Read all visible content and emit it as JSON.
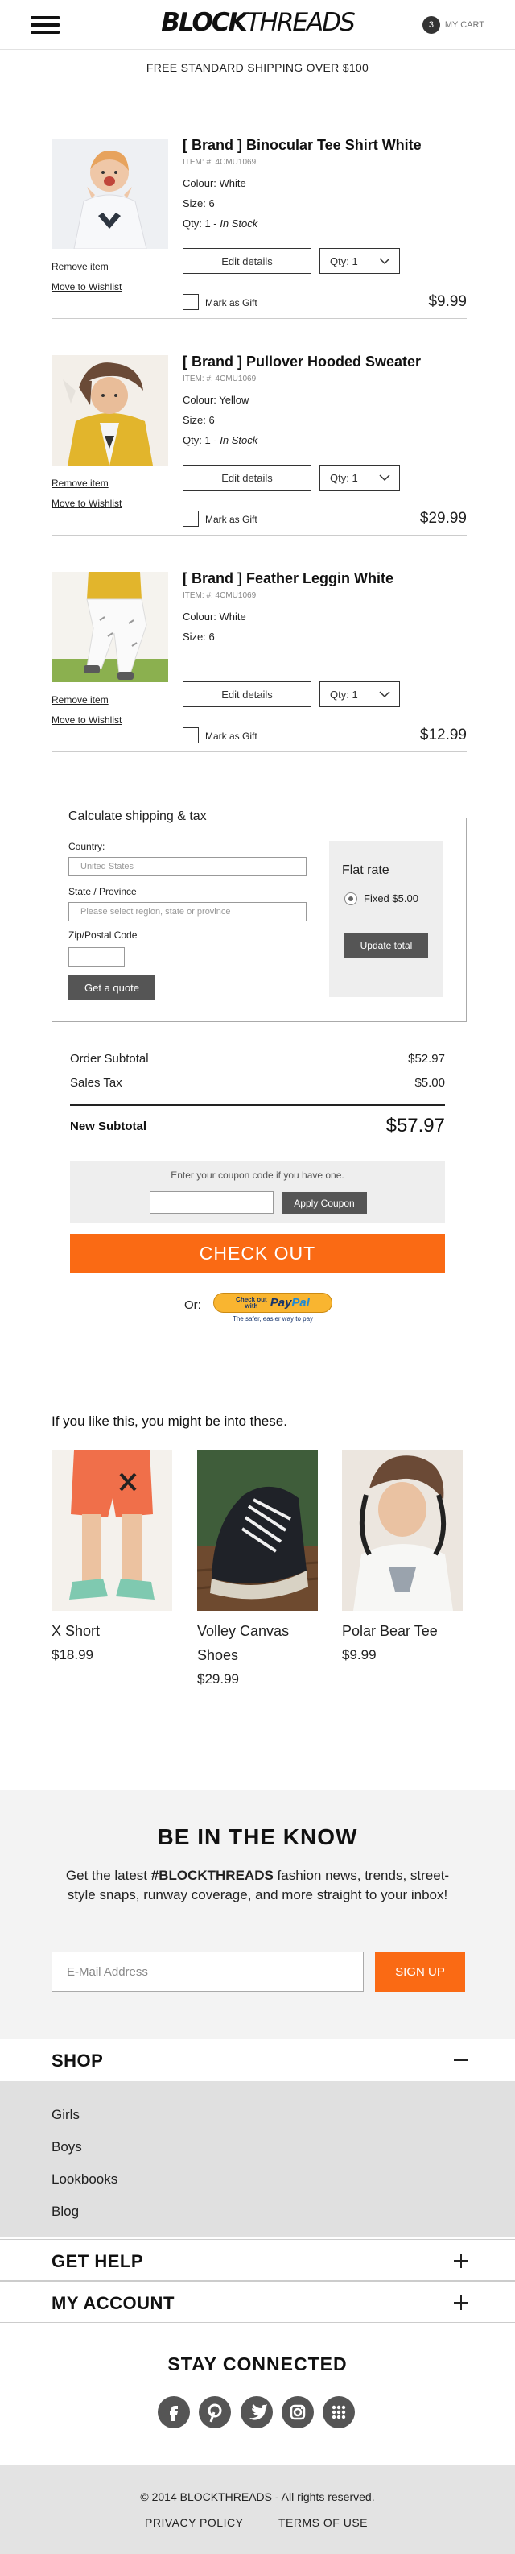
{
  "header": {
    "logo_bold": "BLOCK",
    "logo_thin": "THREADS",
    "cart_count": "3",
    "cart_label": "MY CART"
  },
  "promo": "FREE STANDARD SHIPPING OVER $100",
  "item_actions": {
    "remove": "Remove item",
    "wishlist": "Move to Wishlist",
    "edit": "Edit details",
    "gift": "Mark as Gift"
  },
  "items": [
    {
      "title": "[ Brand ] Binocular Tee Shirt White",
      "sku": "ITEM: #: 4CMU1069",
      "colour": "Colour: White",
      "size": "Size: 6",
      "qty_prefix": "Qty: 1 - ",
      "stock": "In Stock",
      "qty_select": "Qty: 1",
      "price": "$9.99"
    },
    {
      "title": "[ Brand ] Pullover Hooded Sweater",
      "sku": "ITEM: #: 4CMU1069",
      "colour": "Colour:  Yellow",
      "size": "Size: 6",
      "qty_prefix": "Qty: 1 - ",
      "stock": "In Stock",
      "qty_select": "Qty: 1",
      "price": "$29.99"
    },
    {
      "title": "[ Brand ] Feather Leggin White",
      "sku": "ITEM: #: 4CMU1069",
      "colour": "Colour:  White",
      "size": "Size: 6",
      "qty_select": "Qty: 1",
      "price": "$12.99"
    }
  ],
  "shipping": {
    "legend": "Calculate shipping & tax",
    "country_label": "Country:",
    "country_value": "United States",
    "state_label": "State / Province",
    "state_placeholder": "Please select region, state or province",
    "zip_label": "Zip/Postal Code",
    "quote_button": "Get a quote",
    "rate_title": "Flat rate",
    "rate_option": "Fixed $5.00",
    "update_button": "Update total"
  },
  "totals": {
    "subtotal_label": "Order Subtotal",
    "subtotal_value": "$52.97",
    "tax_label": "Sales Tax",
    "tax_value": "$5.00",
    "new_label": "New Subtotal",
    "new_value": "$57.97"
  },
  "coupon": {
    "prompt": "Enter your coupon code if you have one.",
    "button": "Apply Coupon"
  },
  "checkout": {
    "button": "CHECK OUT",
    "or": "Or:",
    "paypal_top": "Check out",
    "paypal_with": "with",
    "paypal_logo_a": "Pay",
    "paypal_logo_b": "Pal",
    "paypal_tagline": "The safer, easier way to pay"
  },
  "recommendations": {
    "heading": "If you like this, you might be into these.",
    "products": [
      {
        "name": "X Short",
        "price": "$18.99"
      },
      {
        "name": "Volley Canvas Shoes",
        "price": "$29.99"
      },
      {
        "name": "Polar Bear Tee",
        "price": "$9.99"
      }
    ]
  },
  "newsletter": {
    "title": "BE IN THE KNOW",
    "text_a": "Get the latest ",
    "text_brand": "#BLOCKTHREADS",
    "text_b": " fashion news, trends, street-style snaps, runway coverage, and more straight to your inbox!",
    "placeholder": "E-Mail Address",
    "button": "SIGN UP"
  },
  "accordions": {
    "shop": "SHOP",
    "help": "GET HELP",
    "account": "MY ACCOUNT"
  },
  "shop_links": [
    "Girls",
    "Boys",
    "Lookbooks",
    "Blog"
  ],
  "social": {
    "title": "STAY CONNECTED",
    "icons": [
      "facebook-icon",
      "pinterest-icon",
      "twitter-icon",
      "instagram-icon",
      "grid-icon"
    ]
  },
  "footer": {
    "copyright": "© 2014 BLOCKTHREADS - All rights reserved.",
    "privacy": "PRIVACY POLICY",
    "terms": "TERMS OF USE"
  },
  "colors": {
    "accent": "#fa6a14",
    "button_dark": "#555555",
    "panel": "#eeeeee"
  }
}
